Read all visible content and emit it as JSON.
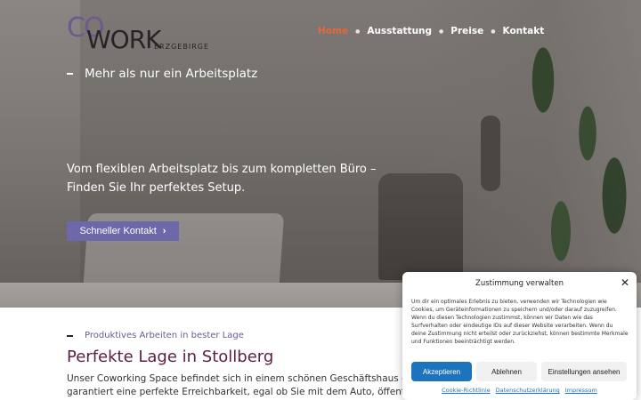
{
  "logo": {
    "co": "CO",
    "work": "WORK",
    "region": "ERZGEBIRGE"
  },
  "nav": {
    "items": [
      {
        "label": "Home",
        "active": true
      },
      {
        "label": "Ausstattung",
        "active": false
      },
      {
        "label": "Preise",
        "active": false
      },
      {
        "label": "Kontakt",
        "active": false
      }
    ]
  },
  "hero": {
    "tagline": "Mehr als nur ein Arbeitsplatz",
    "headline": "Vom flexiblen Arbeitsplatz bis zum kompletten Büro – Finden Sie Ihr perfektes Setup.",
    "cta_label": "Schneller Kontakt",
    "cta_icon": "chevron-right-icon"
  },
  "section": {
    "eyebrow": "Produktives Arbeiten in bester Lage",
    "title": "Perfekte Lage in Stollberg",
    "body_line1": "Unser Coworking Space befindet sich in einem schönen Geschäftshaus direkt im Herzen",
    "body_line2": "garantiert eine perfekte Erreichbarkeit, egal ob Sie mit dem Auto, öffentlichen Verkehrsmitteln"
  },
  "consent": {
    "title": "Zustimmung verwalten",
    "text": "Um dir ein optimales Erlebnis zu bieten, verwenden wir Technologien wie Cookies, um Geräteinformationen zu speichern und/oder darauf zuzugreifen. Wenn du diesen Technologien zustimmst, können wir Daten wie das Surfverhalten oder eindeutige IDs auf dieser Website verarbeiten. Wenn du deine Zustimmung nicht erteilst oder zurückziehst, können bestimmte Merkmale und Funktionen beeinträchtigt werden.",
    "accept_label": "Akzeptieren",
    "deny_label": "Ablehnen",
    "prefs_label": "Einstellungen ansehen",
    "links": [
      "Cookie-Richtlinie",
      "Datenschutzerklärung",
      "Impressum"
    ]
  },
  "colors": {
    "nav_active": "#e8673a",
    "cta_bg": "#6d68a9",
    "section_title": "#5a1e44",
    "accept_bg": "#1e73be"
  }
}
